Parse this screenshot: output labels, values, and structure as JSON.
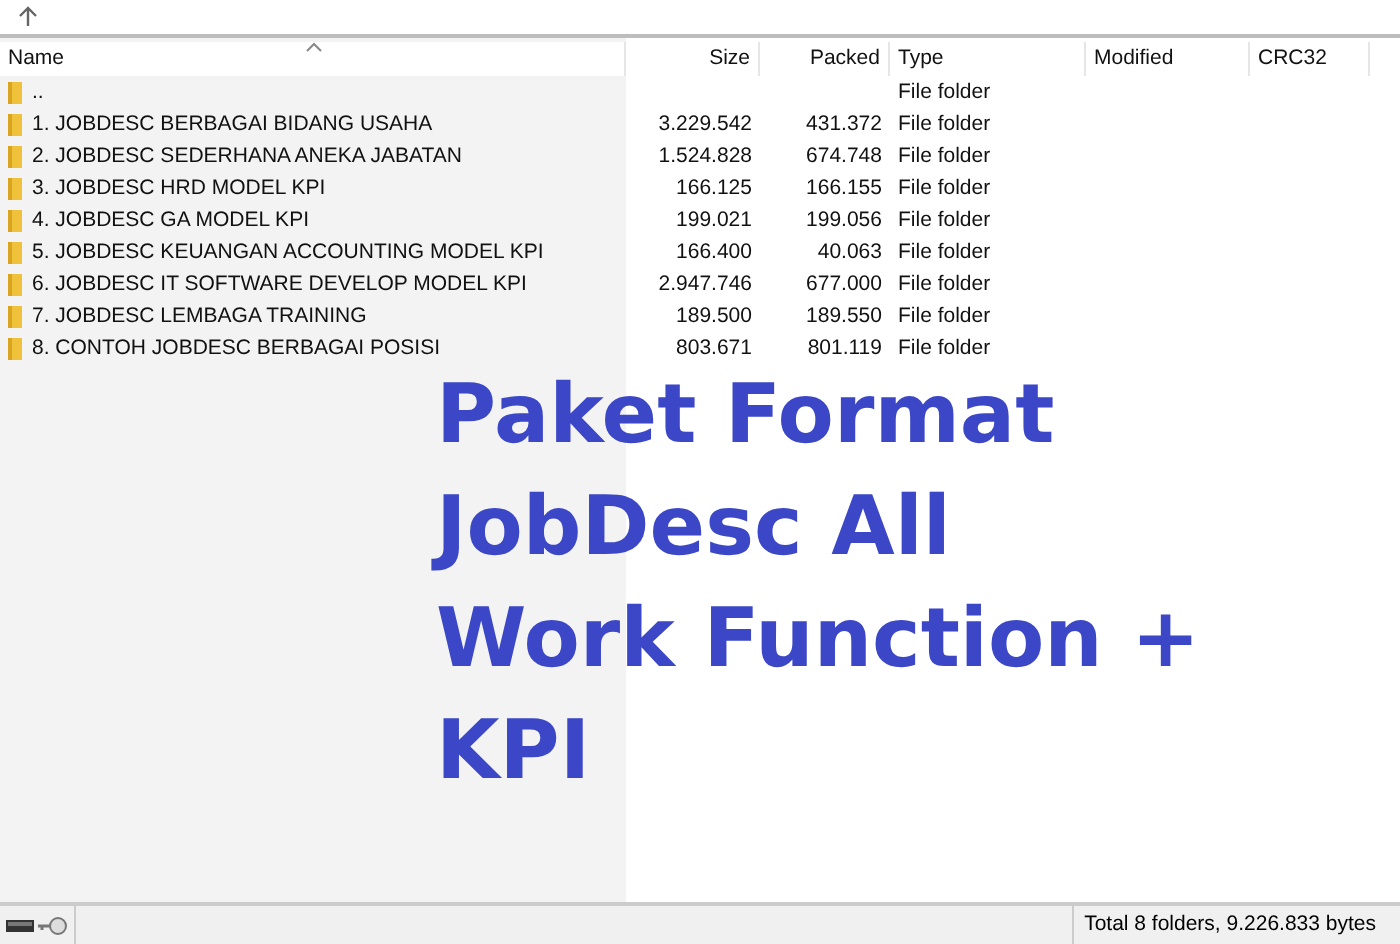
{
  "columns": [
    {
      "label": "Name",
      "sorted": true
    },
    {
      "label": "Size",
      "sorted": false
    },
    {
      "label": "Packed",
      "sorted": false
    },
    {
      "label": "Type",
      "sorted": false
    },
    {
      "label": "Modified",
      "sorted": false
    },
    {
      "label": "CRC32",
      "sorted": false
    }
  ],
  "rows": [
    {
      "name": "..",
      "size": "",
      "packed": "",
      "type": "File folder"
    },
    {
      "name": "1. JOBDESC BERBAGAI BIDANG USAHA",
      "size": "3.229.542",
      "packed": "431.372",
      "type": "File folder"
    },
    {
      "name": "2. JOBDESC SEDERHANA ANEKA JABATAN",
      "size": "1.524.828",
      "packed": "674.748",
      "type": "File folder"
    },
    {
      "name": "3. JOBDESC HRD MODEL KPI",
      "size": "166.125",
      "packed": "166.155",
      "type": "File folder"
    },
    {
      "name": "4. JOBDESC GA MODEL KPI",
      "size": "199.021",
      "packed": "199.056",
      "type": "File folder"
    },
    {
      "name": "5. JOBDESC KEUANGAN ACCOUNTING MODEL KPI",
      "size": "166.400",
      "packed": "40.063",
      "type": "File folder"
    },
    {
      "name": "6. JOBDESC IT SOFTWARE DEVELOP MODEL KPI",
      "size": "2.947.746",
      "packed": "677.000",
      "type": "File folder"
    },
    {
      "name": "7. JOBDESC LEMBAGA TRAINING",
      "size": "189.500",
      "packed": "189.550",
      "type": "File folder"
    },
    {
      "name": "8. CONTOH JOBDESC BERBAGAI POSISI",
      "size": "803.671",
      "packed": "801.119",
      "type": "File folder"
    }
  ],
  "overlay_title": [
    "Paket Format",
    "JobDesc All",
    "Work Function +",
    "KPI"
  ],
  "status_bar": "Total 8 folders, 9.226.833 bytes"
}
